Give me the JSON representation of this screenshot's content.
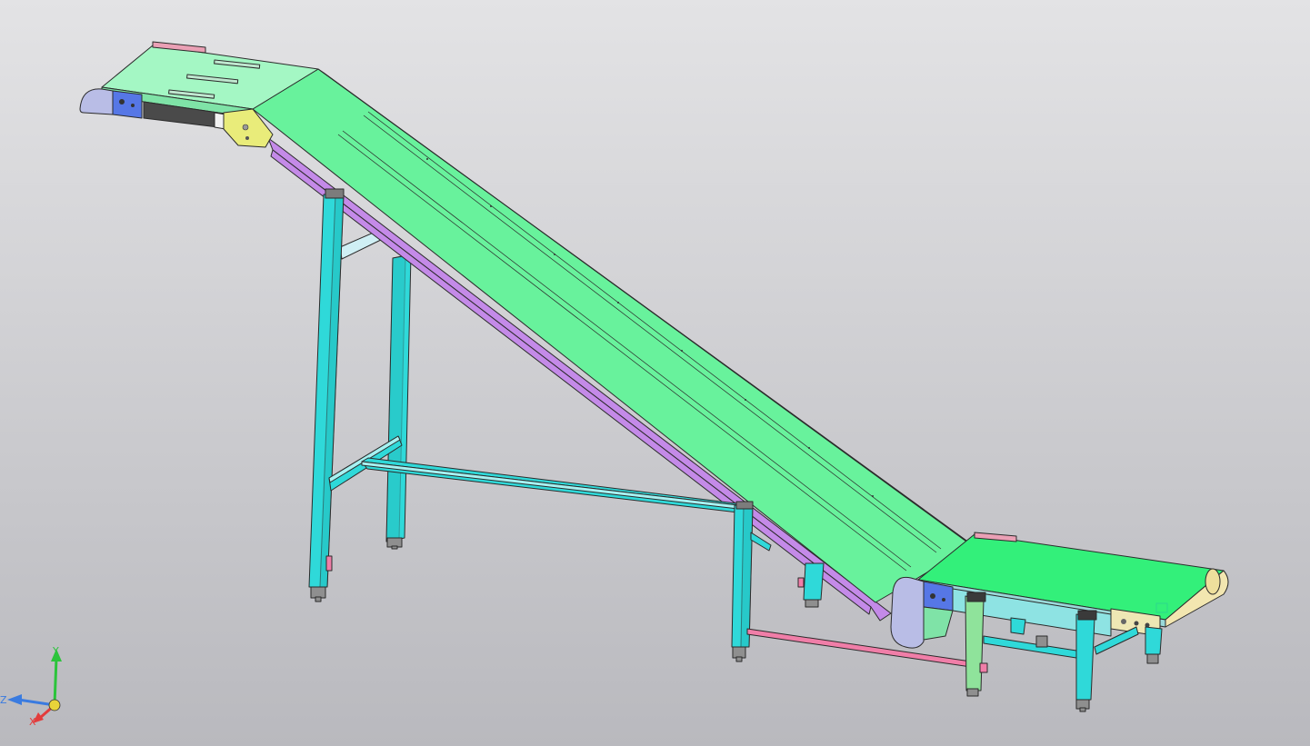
{
  "view": {
    "background_top": "#e3e3e5",
    "background_bottom": "#b9b9be"
  },
  "colors": {
    "belt_incline": "#68f29c",
    "belt_top": "#a4f7c4",
    "belt_bottom": "#33f07a",
    "frame_side": "#c48ae8",
    "legs": "#2fd9d9",
    "leg_green": "#8fe39b",
    "motor": "#b9bde6",
    "plate_blue": "#5677e6",
    "plate_yellow": "#e9ec7a",
    "plate_cream": "#eee7b4",
    "rod": "#f07ea8",
    "foot": "#8f8f8f"
  },
  "axes": {
    "y": {
      "label": "Y",
      "color": "#2bc43b"
    },
    "z": {
      "label": "Z",
      "color": "#3a7be0"
    },
    "x": {
      "label": "X",
      "color": "#e33c3c"
    },
    "origin_color": "#e8d33a"
  }
}
